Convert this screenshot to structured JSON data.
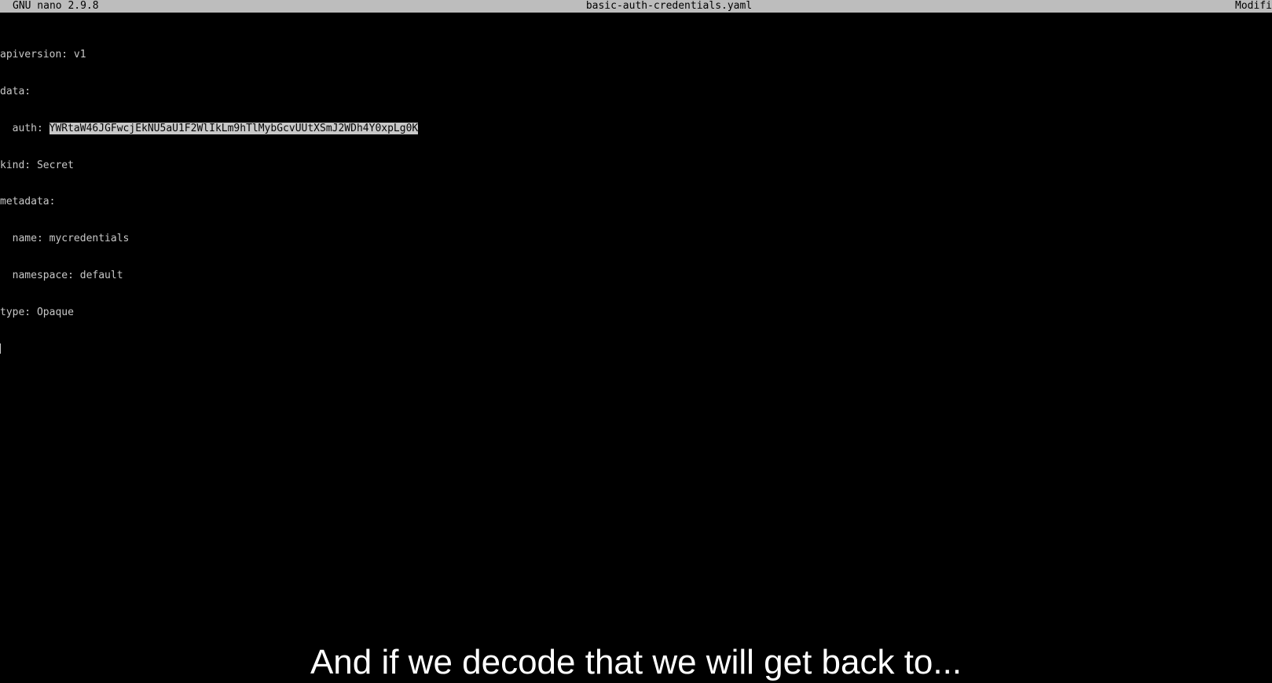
{
  "titlebar": {
    "app_version": "GNU nano 2.9.8",
    "file_name": "basic-auth-credentials.yaml",
    "status": "Modifi"
  },
  "editor": {
    "lines": [
      "apiversion: v1",
      "data:",
      "  auth: ",
      "kind: Secret",
      "metadata:",
      "  name: mycredentials",
      "  namespace: default",
      "type: Opaque"
    ],
    "selected_value": "YWRtaW46JGFwcjEkNU5aU1F2WlIkLm9hTlMybGcvUUtXSmJ2WDh4Y0xpLg0K"
  },
  "subtitle": "And if we decode that we will get back to...",
  "colors": {
    "background": "#000000",
    "text": "#c8c8c8",
    "titlebar": "#bdbdbd",
    "selection": "#c8c8c8"
  },
  "icons": {
    "mouse_pointer": "i-beam-cursor-icon",
    "text_cursor": "text-cursor-icon"
  }
}
